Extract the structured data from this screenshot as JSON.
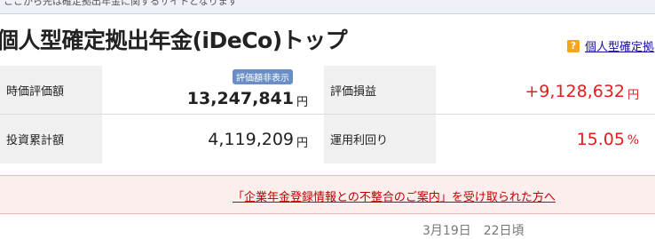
{
  "top_bar_text": "ここから先は確定拠出年金に関するサイトとなります",
  "page_title": "個人型確定拠出年金(iDeCo)トップ",
  "help_link": {
    "icon": "question-icon",
    "icon_glyph": "?",
    "label": "個人型確定拠"
  },
  "summary": {
    "valuation": {
      "label": "時価評価額",
      "badge": "評価額非表示",
      "value": "13,247,841",
      "unit": "円"
    },
    "gain": {
      "label": "評価損益",
      "value": "+9,128,632",
      "unit": "円"
    },
    "invested": {
      "label": "投資累計額",
      "value": "4,119,209",
      "unit": "円"
    },
    "yield": {
      "label": "運用利回り",
      "value": "15.05",
      "unit": "%"
    }
  },
  "notice": {
    "link_text": "「企業年金登録情報との不整合のご案内」を受け取られた方へ"
  },
  "footer_partial": "3月19日　22日頃"
}
